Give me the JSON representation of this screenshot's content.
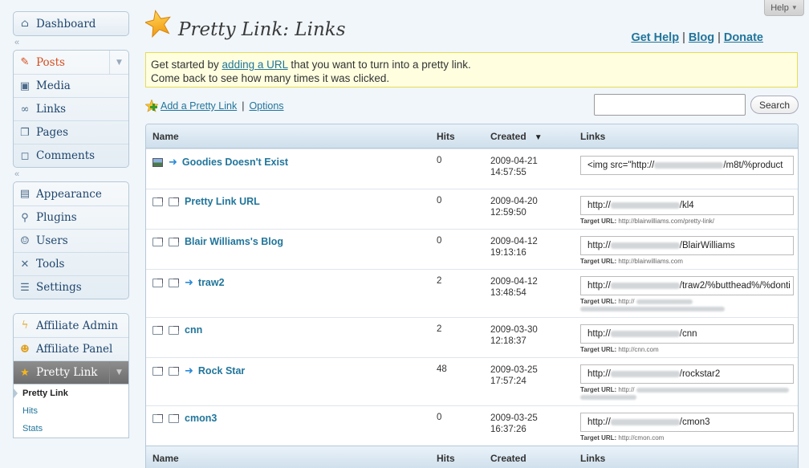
{
  "help": {
    "label": "Help"
  },
  "header": {
    "title": "Pretty Link: Links",
    "links": [
      "Get Help",
      "Blog",
      "Donate"
    ],
    "separator": "|"
  },
  "notice": {
    "line1_prefix": "Get started by ",
    "line1_link": "adding a URL",
    "line1_suffix": " that you want to turn into a pretty link.",
    "line2": "Come back to see how many times it was clicked."
  },
  "toolbar": {
    "add_label": "Add a Pretty Link",
    "separator": "|",
    "options_label": "Options",
    "search_value": "",
    "search_button": "Search"
  },
  "sidebar": {
    "group1": [
      {
        "label": "Dashboard",
        "icon": "house-icon"
      }
    ],
    "group2": [
      {
        "label": "Posts",
        "icon": "pin-icon"
      },
      {
        "label": "Media",
        "icon": "media-icon"
      },
      {
        "label": "Links",
        "icon": "chain-icon"
      },
      {
        "label": "Pages",
        "icon": "pages-icon"
      },
      {
        "label": "Comments",
        "icon": "speech-bubble-icon"
      }
    ],
    "group3": [
      {
        "label": "Appearance",
        "icon": "appearance-icon"
      },
      {
        "label": "Plugins",
        "icon": "plug-icon"
      },
      {
        "label": "Users",
        "icon": "users-icon"
      },
      {
        "label": "Tools",
        "icon": "tools-icon"
      },
      {
        "label": "Settings",
        "icon": "settings-icon"
      }
    ],
    "group4": [
      {
        "label": "Affiliate Admin",
        "icon": "bolt-icon"
      },
      {
        "label": "Affiliate Panel",
        "icon": "smiley-icon"
      },
      {
        "label": "Pretty Link",
        "icon": "star-icon"
      }
    ],
    "submenu": [
      "Pretty Link",
      "Hits",
      "Stats"
    ],
    "collapse_glyph": "«"
  },
  "table": {
    "headers": {
      "name": "Name",
      "hits": "Hits",
      "created": "Created",
      "links": "Links"
    },
    "target_label": "Target URL:",
    "rows": [
      {
        "name": "Goodies Doesn't Exist",
        "hits": "0",
        "date": "2009-04-21",
        "time": "14:57:55",
        "link_prefix": "<img src=\"http://",
        "link_suffix": "/m8t/%product",
        "target": ""
      },
      {
        "name": "Pretty Link URL",
        "hits": "0",
        "date": "2009-04-20",
        "time": "12:59:50",
        "link_prefix": "http://",
        "link_suffix": "/kl4",
        "target": "http://blairwilliams.com/pretty-link/"
      },
      {
        "name": "Blair Williams's Blog",
        "hits": "0",
        "date": "2009-04-12",
        "time": "19:13:16",
        "link_prefix": "http://",
        "link_suffix": "/BlairWilliams",
        "target": "http://blairwilliams.com"
      },
      {
        "name": "traw2",
        "hits": "2",
        "date": "2009-04-12",
        "time": "13:48:54",
        "link_prefix": "http://",
        "link_suffix": "/traw2/%butthead%/%donti",
        "target": "http://"
      },
      {
        "name": "cnn",
        "hits": "2",
        "date": "2009-03-30",
        "time": "12:18:37",
        "link_prefix": "http://",
        "link_suffix": "/cnn",
        "target": "http://cnn.com"
      },
      {
        "name": "Rock Star",
        "hits": "48",
        "date": "2009-03-25",
        "time": "17:57:24",
        "link_prefix": "http://",
        "link_suffix": "/rockstar2",
        "target": "http://"
      },
      {
        "name": "cmon3",
        "hits": "0",
        "date": "2009-03-25",
        "time": "16:37:26",
        "link_prefix": "http://",
        "link_suffix": "/cmon3",
        "target": "http://cmon.com"
      }
    ]
  },
  "colors": {
    "link": "#21759b",
    "notice_bg": "#ffffe0",
    "active_menu": "#7a7a7a",
    "accent_red": "#d54e21"
  }
}
